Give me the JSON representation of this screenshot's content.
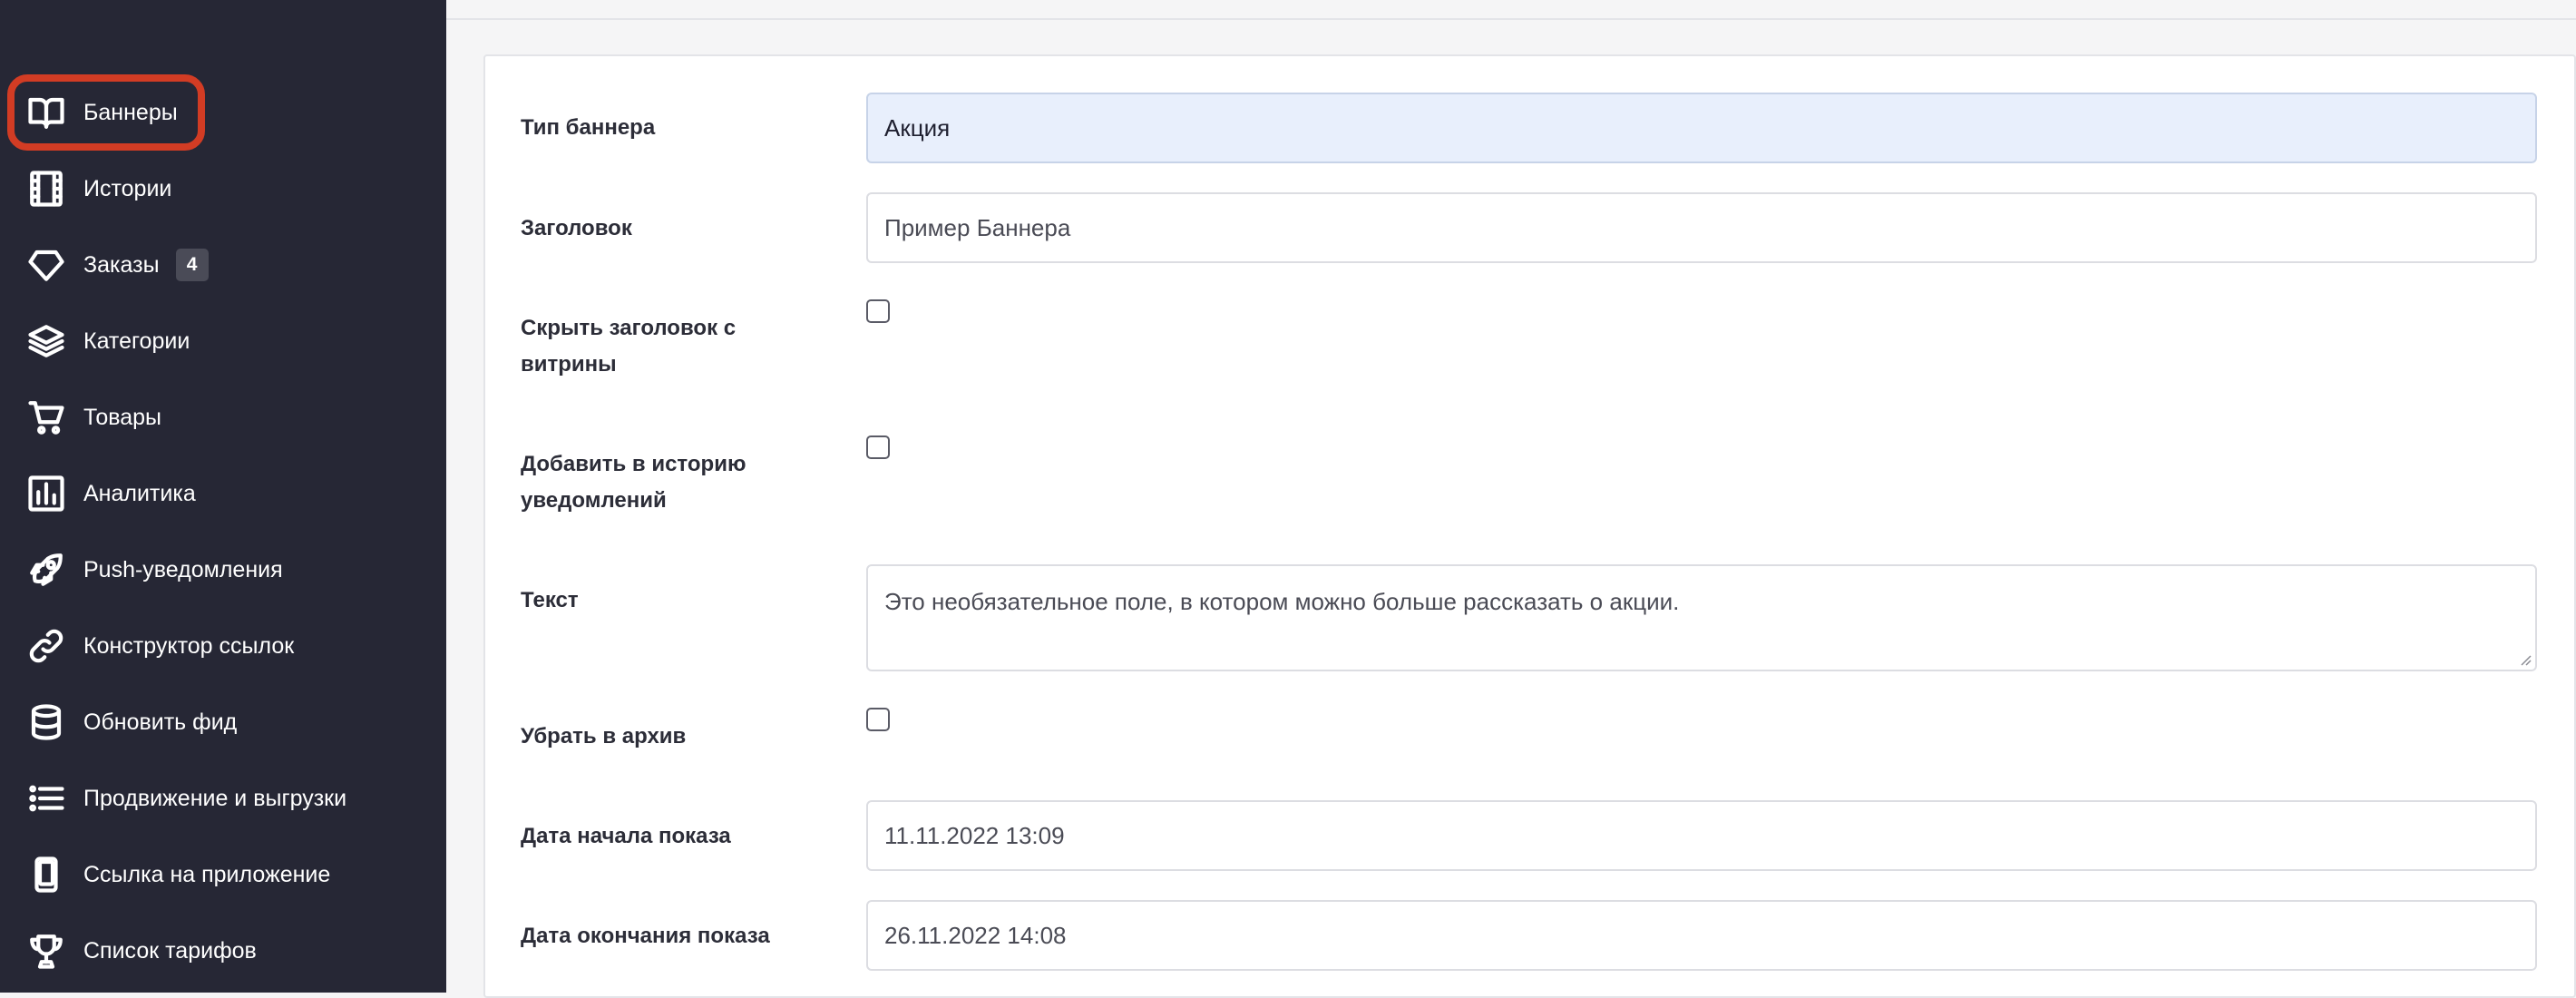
{
  "sidebar": {
    "items": [
      {
        "label": "Баннеры",
        "icon": "book-open-icon"
      },
      {
        "label": "Истории",
        "icon": "film-icon"
      },
      {
        "label": "Заказы",
        "icon": "diamond-icon",
        "badge": "4"
      },
      {
        "label": "Категории",
        "icon": "layers-icon"
      },
      {
        "label": "Товары",
        "icon": "shopping-cart-icon"
      },
      {
        "label": "Аналитика",
        "icon": "bar-chart-icon"
      },
      {
        "label": "Push-уведомления",
        "icon": "rocket-icon"
      },
      {
        "label": "Конструктор ссылок",
        "icon": "link-icon"
      },
      {
        "label": "Обновить фид",
        "icon": "database-icon"
      },
      {
        "label": "Продвижение и выгрузки",
        "icon": "list-icon"
      },
      {
        "label": "Ссылка на приложение",
        "icon": "smartphone-icon"
      },
      {
        "label": "Список тарифов",
        "icon": "trophy-icon"
      }
    ]
  },
  "form": {
    "banner_type": {
      "label": "Тип баннера",
      "value": "Акция"
    },
    "title": {
      "label": "Заголовок",
      "value": "Пример Баннера"
    },
    "hide_title": {
      "label": "Скрыть заголовок с витрины",
      "checked": false
    },
    "add_to_history": {
      "label": "Добавить в историю уведомлений",
      "checked": false
    },
    "text": {
      "label": "Текст",
      "value": "Это необязательное поле, в котором можно больше рассказать о акции."
    },
    "archive": {
      "label": "Убрать в архив",
      "checked": false
    },
    "start_date": {
      "label": "Дата начала показа",
      "value": "11.11.2022 13:09"
    },
    "end_date": {
      "label": "Дата окончания показа",
      "value": "26.11.2022 14:08"
    }
  },
  "colors": {
    "sidebar_bg": "#262735",
    "highlight": "#d23c24",
    "select_bg": "#e8effc"
  }
}
